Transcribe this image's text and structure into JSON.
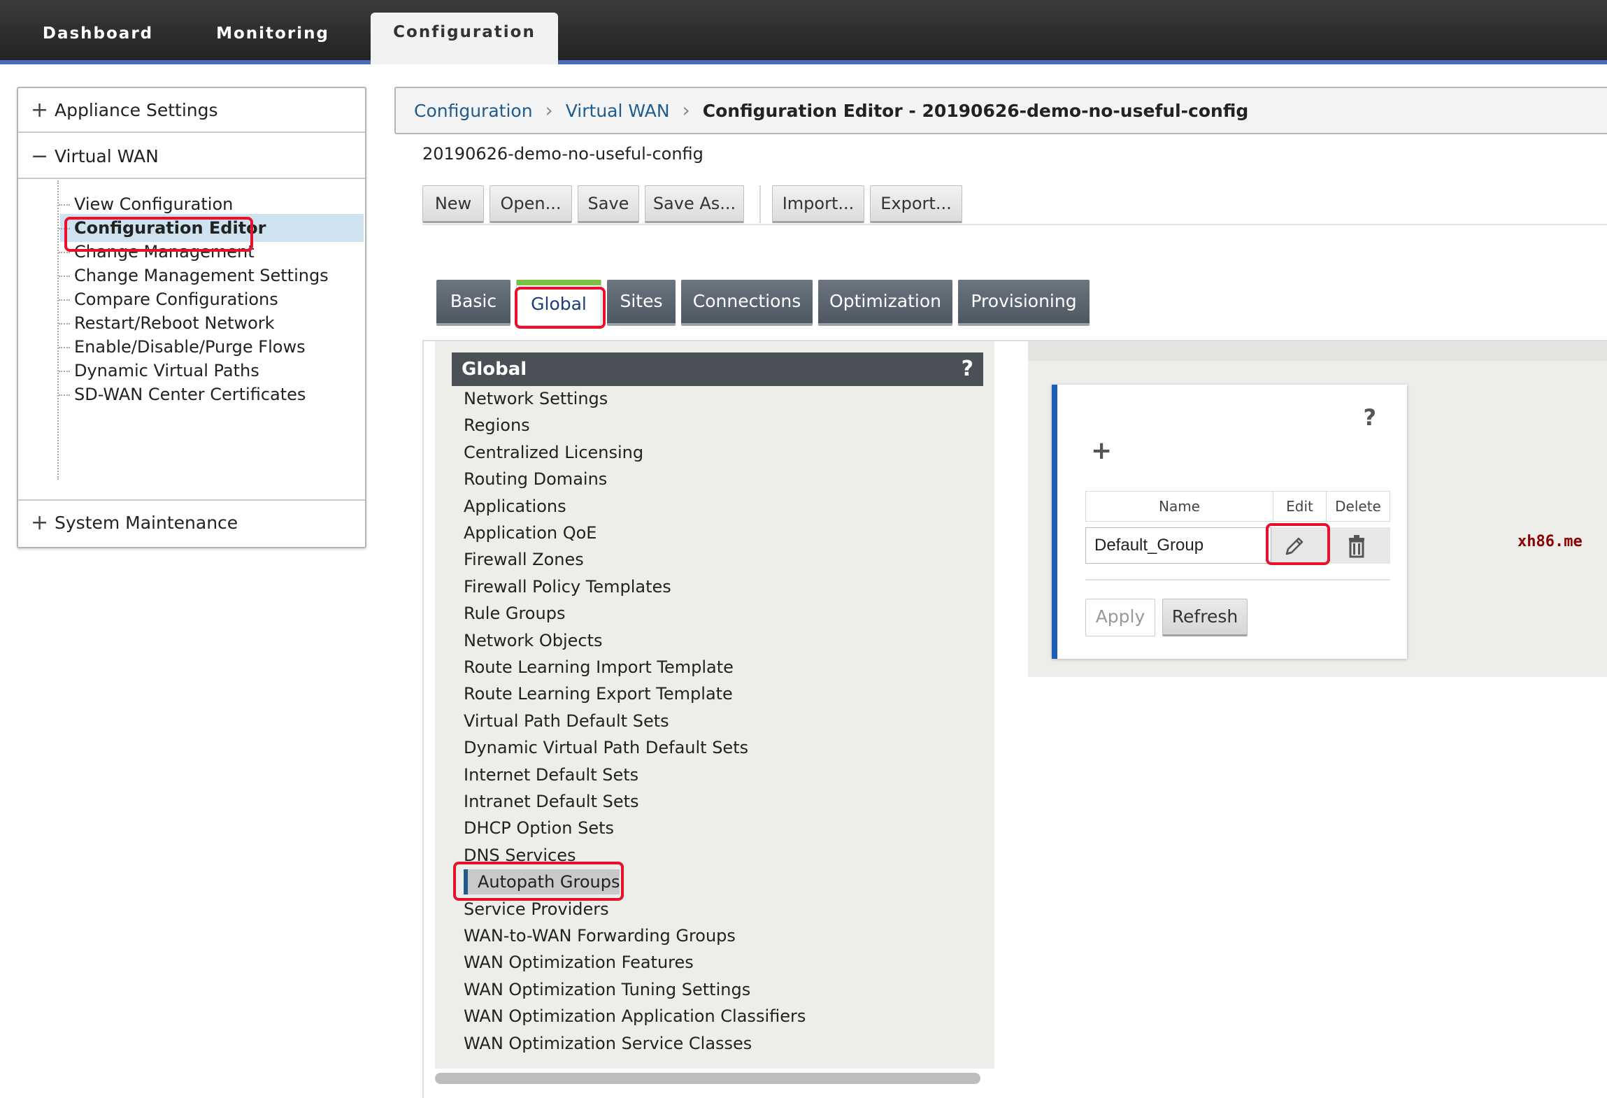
{
  "topnav": {
    "tabs": [
      {
        "label": "Dashboard"
      },
      {
        "label": "Monitoring"
      },
      {
        "label": "Configuration"
      }
    ],
    "active": "Configuration"
  },
  "sidebar": {
    "sections": [
      {
        "label": "Appliance Settings",
        "sign": "+"
      },
      {
        "label": "Virtual WAN",
        "sign": "−"
      },
      {
        "label": "System Maintenance",
        "sign": "+"
      }
    ],
    "virtual_wan_items": [
      {
        "label": "View Configuration"
      },
      {
        "label": "Configuration Editor"
      },
      {
        "label": "Change Management"
      },
      {
        "label": "Change Management Settings"
      },
      {
        "label": "Compare Configurations"
      },
      {
        "label": "Restart/Reboot Network"
      },
      {
        "label": "Enable/Disable/Purge Flows"
      },
      {
        "label": "Dynamic Virtual Paths"
      },
      {
        "label": "SD-WAN Center Certificates"
      }
    ],
    "active_item": "Configuration Editor"
  },
  "breadcrumb": {
    "items": [
      "Configuration",
      "Virtual WAN"
    ],
    "current": "Configuration Editor - 20190626-demo-no-useful-config"
  },
  "config_name": "20190626-demo-no-useful-config",
  "toolbar": {
    "buttons": [
      "New",
      "Open...",
      "Save",
      "Save As...",
      "Import...",
      "Export..."
    ]
  },
  "tabs": {
    "items": [
      "Basic",
      "Global",
      "Sites",
      "Connections",
      "Optimization",
      "Provisioning"
    ],
    "active": "Global"
  },
  "global_list": {
    "title": "Global",
    "help": "?",
    "items": [
      "Network Settings",
      "Regions",
      "Centralized Licensing",
      "Routing Domains",
      "Applications",
      "Application QoE",
      "Firewall Zones",
      "Firewall Policy Templates",
      "Rule Groups",
      "Network Objects",
      "Route Learning Import Template",
      "Route Learning Export Template",
      "Virtual Path Default Sets",
      "Dynamic Virtual Path Default Sets",
      "Internet Default Sets",
      "Intranet Default Sets",
      "DHCP Option Sets",
      "DNS Services",
      "Autopath Groups",
      "Service Providers",
      "WAN-to-WAN Forwarding Groups",
      "WAN Optimization Features",
      "WAN Optimization Tuning Settings",
      "WAN Optimization Application Classifiers",
      "WAN Optimization Service Classes"
    ],
    "selected": "Autopath Groups"
  },
  "autopath_card": {
    "help": "?",
    "add": "+",
    "columns": [
      "Name",
      "Edit",
      "Delete"
    ],
    "rows": [
      {
        "name": "Default_Group"
      }
    ],
    "apply_label": "Apply",
    "refresh_label": "Refresh",
    "edit_icon": "pencil-icon",
    "delete_icon": "trash-icon"
  },
  "watermark": "xh86.me",
  "colors": {
    "accent_blue": "#1d5fb6",
    "highlight_red": "#e8112d",
    "tab_active_green": "#7ac143",
    "link": "#1d5c8f"
  }
}
